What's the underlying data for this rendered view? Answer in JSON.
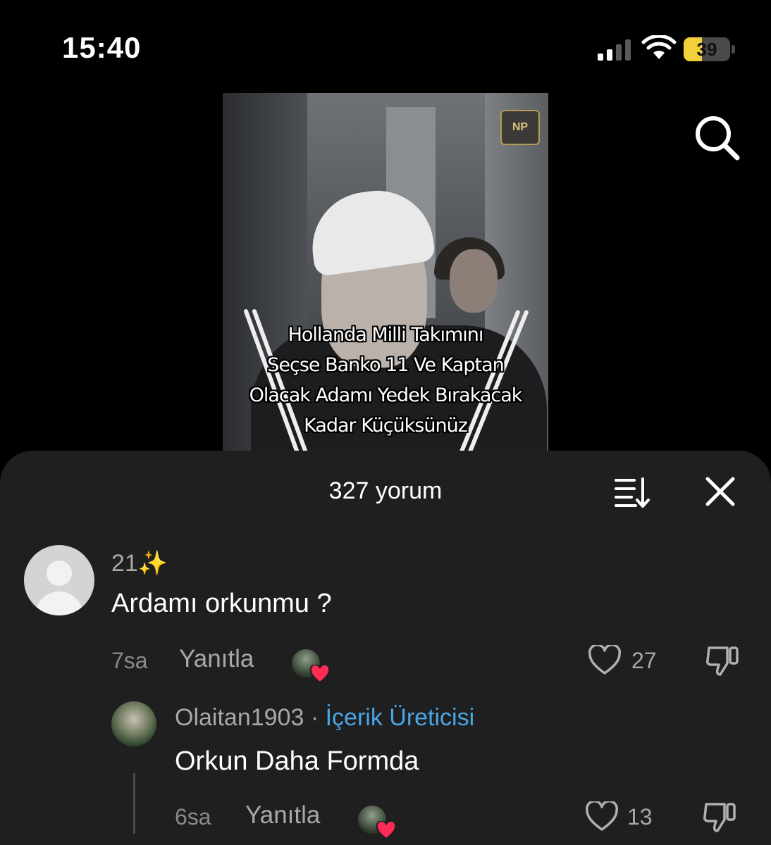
{
  "status_bar": {
    "time": "15:40",
    "battery_level": "39",
    "battery_fraction": 0.39,
    "battery_color": "#f2d03a",
    "icons": [
      "cellular-signal-icon",
      "wifi-icon",
      "battery-icon"
    ]
  },
  "header": {
    "search_icon": "search-icon"
  },
  "video": {
    "watermark": "NP",
    "caption_lines": [
      "Hollanda Milli Takımını",
      "Seçse Banko 11 Ve Kaptan",
      "Olacak Adamı Yedek Bırakacak",
      "Kadar Küçüksünüz"
    ]
  },
  "comments_panel": {
    "title": "327 yorum",
    "sort_icon": "sort-icon",
    "close_icon": "close-icon",
    "comments": [
      {
        "user": "21✨",
        "text": "Ardamı orkunmu ?",
        "time": "7sa",
        "reply_label": "Yanıtla",
        "likes": "27",
        "liked_by_creator": true
      }
    ],
    "reply": {
      "user": "Olaitan1903",
      "separator": " · ",
      "badge": "İçerik Üreticisi",
      "text": "Orkun Daha Formda",
      "time": "6sa",
      "reply_label": "Yanıtla",
      "likes": "13",
      "liked_by_creator": true
    },
    "colors": {
      "background": "#1f1f1f",
      "creator_badge": "#49a6e6",
      "heart": "#fe2c55"
    }
  }
}
